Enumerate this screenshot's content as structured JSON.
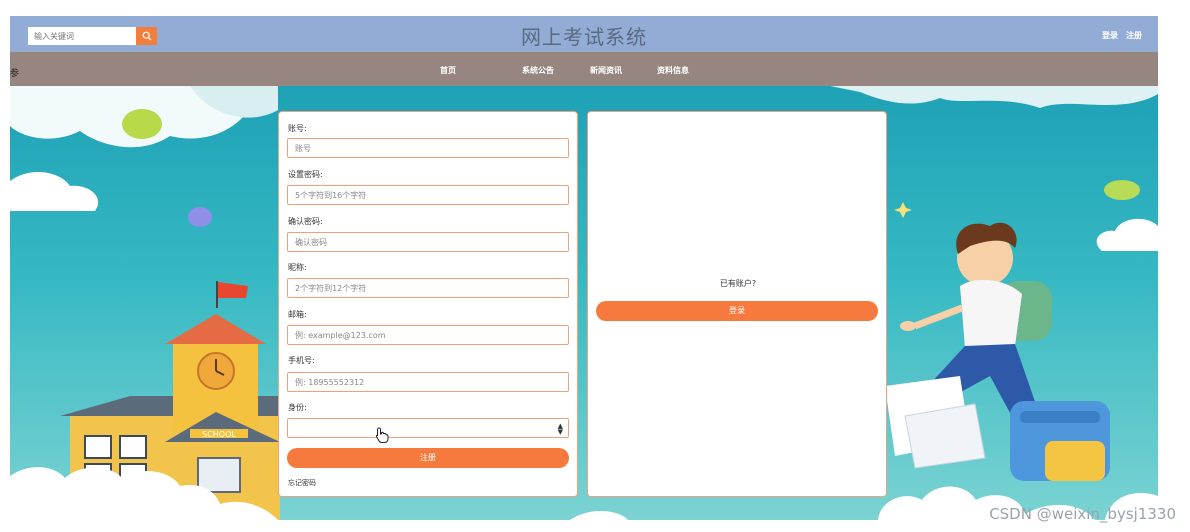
{
  "header": {
    "search_placeholder": "输入关键词",
    "search_icon": "search-icon",
    "title": "网上考试系统",
    "login_link": "登录",
    "register_link": "注册"
  },
  "nav": {
    "left_mark": "参",
    "items": [
      {
        "label": "首页"
      },
      {
        "label": "系统公告"
      },
      {
        "label": "新闻资讯"
      },
      {
        "label": "资料信息"
      }
    ]
  },
  "register_form": {
    "fields": [
      {
        "label": "账号:",
        "placeholder": "账号"
      },
      {
        "label": "设置密码:",
        "placeholder": "5个字符到16个字符"
      },
      {
        "label": "确认密码:",
        "placeholder": "确认密码"
      },
      {
        "label": "昵称:",
        "placeholder": "2个字符到12个字符"
      },
      {
        "label": "邮箱:",
        "placeholder": "例: example@123.com"
      },
      {
        "label": "手机号:",
        "placeholder": "例: 18955552312"
      }
    ],
    "identity_label": "身份:",
    "identity_value": "",
    "submit_label": "注册",
    "forgot_label": "忘记密码"
  },
  "login_side": {
    "prompt": "已有账户?",
    "login_label": "登录"
  },
  "watermark": "CSDN @weixin_bysj1330",
  "colors": {
    "header_bg": "#93acd6",
    "nav_bg": "#978680",
    "accent": "#f67a3d",
    "scene_bg": "#37b9c3"
  }
}
